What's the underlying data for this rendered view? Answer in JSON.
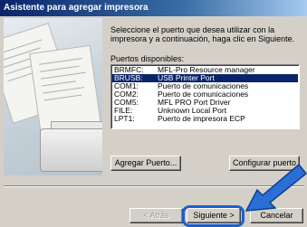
{
  "window": {
    "title": "Asistente para agregar impresora"
  },
  "instructions": "Seleccione el puerto que desea utilizar con la impresora y a continuación, haga clic en Siguiente.",
  "ports": {
    "label": "Puertos disponibles:",
    "items": [
      {
        "name": "BRMFC:",
        "desc": "MFL-Pro Resource manager",
        "selected": false
      },
      {
        "name": "BRUSB:",
        "desc": "USB Printer Port",
        "selected": true
      },
      {
        "name": "COM1:",
        "desc": "Puerto de comunicaciones",
        "selected": false
      },
      {
        "name": "COM2:",
        "desc": "Puerto de comunicaciones",
        "selected": false
      },
      {
        "name": "COM5:",
        "desc": "MFL PRO Port Driver",
        "selected": false
      },
      {
        "name": "FILE:",
        "desc": "Unknown Local Port",
        "selected": false
      },
      {
        "name": "LPT1:",
        "desc": "Puerto de impresora ECP",
        "selected": false
      }
    ]
  },
  "buttons": {
    "add_port": "Agregar Puerto...",
    "configure_port": "Configurar puerto",
    "back": "< Atrás",
    "next": "Siguiente >",
    "cancel": "Cancelar"
  },
  "colors": {
    "selection": "#0a246a",
    "highlight_ring": "#1a5fd0",
    "arrow": "#2a6fd6"
  }
}
